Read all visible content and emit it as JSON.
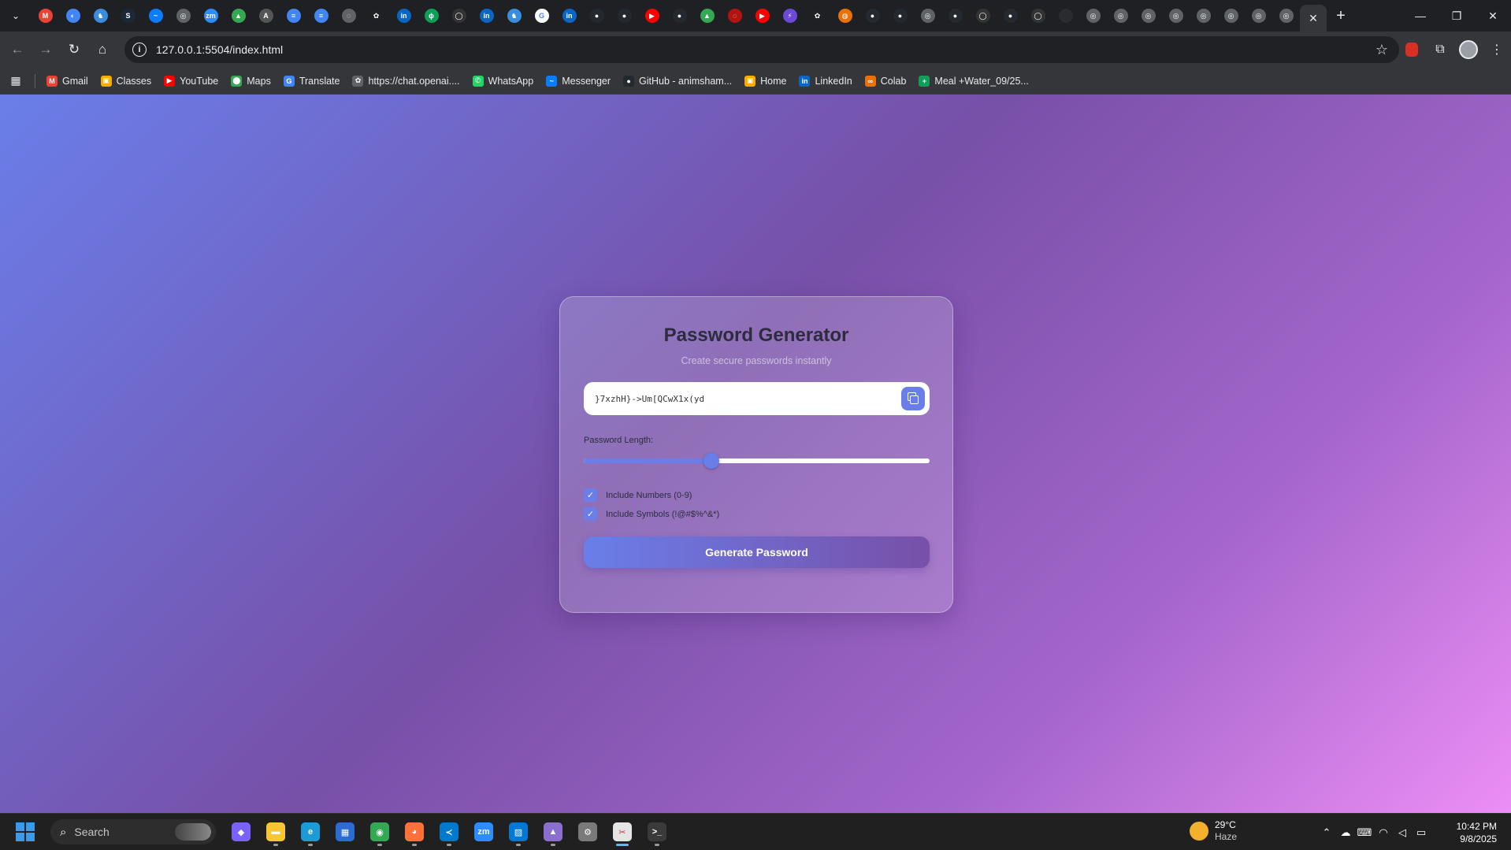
{
  "browser": {
    "url": "127.0.0.1:5504/index.html",
    "tabs": [
      {
        "icon": "gmail-icon",
        "color": "#ea4335",
        "glyph": "M"
      },
      {
        "icon": "chart-icon",
        "color": "#4285f4",
        "glyph": "◐"
      },
      {
        "icon": "github-copilot-icon",
        "color": "#3a8dde",
        "glyph": "♞"
      },
      {
        "icon": "steam-icon",
        "color": "#1b2838",
        "glyph": "S"
      },
      {
        "icon": "messenger-icon",
        "color": "#0a7cff",
        "glyph": "~"
      },
      {
        "icon": "globe-icon",
        "color": "#5f6368",
        "glyph": "◎"
      },
      {
        "icon": "zoom-icon",
        "color": "#2d8cff",
        "glyph": "zm"
      },
      {
        "icon": "drive-icon",
        "color": "#34a853",
        "glyph": "▲"
      },
      {
        "icon": "angular-icon",
        "color": "#555",
        "glyph": "A"
      },
      {
        "icon": "docs-icon",
        "color": "#4285f4",
        "glyph": "≡"
      },
      {
        "icon": "docs-icon",
        "color": "#4285f4",
        "glyph": "≡"
      },
      {
        "icon": "loading-icon",
        "color": "#5f6368",
        "glyph": "◌"
      },
      {
        "icon": "chatgpt-icon",
        "color": "#202124",
        "glyph": "✿"
      },
      {
        "icon": "linkedin-icon",
        "color": "#0a66c2",
        "glyph": "in"
      },
      {
        "icon": "plant-icon",
        "color": "#0f9d58",
        "glyph": "ϕ"
      },
      {
        "icon": "circle-icon",
        "color": "#333",
        "glyph": "◯"
      },
      {
        "icon": "linkedin-icon",
        "color": "#0a66c2",
        "glyph": "in"
      },
      {
        "icon": "copilot-icon",
        "color": "#3a8dde",
        "glyph": "♞"
      },
      {
        "icon": "google-icon",
        "color": "#ffffff",
        "glyph": "G"
      },
      {
        "icon": "linkedin-icon",
        "color": "#0a66c2",
        "glyph": "in"
      },
      {
        "icon": "github-icon",
        "color": "#24292f",
        "glyph": "●"
      },
      {
        "icon": "github-icon",
        "color": "#24292f",
        "glyph": "●"
      },
      {
        "icon": "youtube-icon",
        "color": "#ff0000",
        "glyph": "▶"
      },
      {
        "icon": "github-icon",
        "color": "#24292f",
        "glyph": "●"
      },
      {
        "icon": "drive-icon",
        "color": "#34a853",
        "glyph": "▲"
      },
      {
        "icon": "loading-icon",
        "color": "#b31412",
        "glyph": "◌"
      },
      {
        "icon": "youtube-icon",
        "color": "#ff0000",
        "glyph": "▶"
      },
      {
        "icon": "bolt-icon",
        "color": "#6c4ad8",
        "glyph": "⚡"
      },
      {
        "icon": "chatgpt-icon",
        "color": "#202124",
        "glyph": "✿"
      },
      {
        "icon": "colab-icon",
        "color": "#e8710a",
        "glyph": "◍"
      },
      {
        "icon": "github-icon",
        "color": "#24292f",
        "glyph": "●"
      },
      {
        "icon": "github-icon",
        "color": "#24292f",
        "glyph": "●"
      },
      {
        "icon": "globe-icon",
        "color": "#5f6368",
        "glyph": "◎"
      },
      {
        "icon": "github-icon",
        "color": "#24292f",
        "glyph": "●"
      },
      {
        "icon": "circle-icon",
        "color": "#333",
        "glyph": "◯"
      },
      {
        "icon": "github-icon",
        "color": "#24292f",
        "glyph": "●"
      },
      {
        "icon": "circle-icon",
        "color": "#333",
        "glyph": "◯"
      },
      {
        "icon": "blank-icon",
        "color": "#2a2b2e",
        "glyph": ""
      },
      {
        "icon": "globe-icon",
        "color": "#5f6368",
        "glyph": "◎"
      },
      {
        "icon": "globe-icon",
        "color": "#5f6368",
        "glyph": "◎"
      },
      {
        "icon": "globe-icon",
        "color": "#5f6368",
        "glyph": "◎"
      },
      {
        "icon": "globe-icon",
        "color": "#5f6368",
        "glyph": "◎"
      },
      {
        "icon": "globe-icon",
        "color": "#5f6368",
        "glyph": "◎"
      },
      {
        "icon": "globe-icon",
        "color": "#5f6368",
        "glyph": "◎"
      },
      {
        "icon": "globe-icon",
        "color": "#5f6368",
        "glyph": "◎"
      },
      {
        "icon": "globe-icon",
        "color": "#5f6368",
        "glyph": "◎"
      }
    ],
    "bookmarks": [
      {
        "label": "Gmail",
        "color": "#ea4335",
        "glyph": "M"
      },
      {
        "label": "Classes",
        "color": "#f9ab00",
        "glyph": "▣"
      },
      {
        "label": "YouTube",
        "color": "#ff0000",
        "glyph": "▶"
      },
      {
        "label": "Maps",
        "color": "#34a853",
        "glyph": "⬤"
      },
      {
        "label": "Translate",
        "color": "#4285f4",
        "glyph": "G"
      },
      {
        "label": "https://chat.openai....",
        "color": "#5f6368",
        "glyph": "✿"
      },
      {
        "label": "WhatsApp",
        "color": "#25d366",
        "glyph": "✆"
      },
      {
        "label": "Messenger",
        "color": "#0a7cff",
        "glyph": "~"
      },
      {
        "label": "GitHub - animsham...",
        "color": "#24292f",
        "glyph": "●"
      },
      {
        "label": "Home",
        "color": "#f9ab00",
        "glyph": "▣"
      },
      {
        "label": "LinkedIn",
        "color": "#0a66c2",
        "glyph": "in"
      },
      {
        "label": "Colab",
        "color": "#e8710a",
        "glyph": "∞"
      },
      {
        "label": "Meal +Water_09/25...",
        "color": "#0f9d58",
        "glyph": "+"
      }
    ]
  },
  "app": {
    "title": "Password Generator",
    "subtitle": "Create secure passwords instantly",
    "password": "}7xzhH}->Um[QCwX1x(yd",
    "length_label": "Password Length:",
    "length_value": "",
    "length_fraction": 0.37,
    "numbers_label": "Include Numbers (0-9)",
    "numbers_checked": true,
    "symbols_label": "Include Symbols (!@#$%^&*)",
    "symbols_checked": true,
    "generate_label": "Generate Password",
    "accent_color": "#6a7ee9"
  },
  "taskbar": {
    "search_placeholder": "Search",
    "apps": [
      {
        "name": "copilot-icon",
        "color": "#7b61ff",
        "glyph": "◆"
      },
      {
        "name": "file-explorer-icon",
        "color": "#f8c633",
        "glyph": "▬"
      },
      {
        "name": "edge-icon",
        "color": "#1d9bd6",
        "glyph": "e"
      },
      {
        "name": "store-icon",
        "color": "#2b6cd3",
        "glyph": "▦"
      },
      {
        "name": "chrome-icon",
        "color": "#34a853",
        "glyph": "◉"
      },
      {
        "name": "firefox-icon",
        "color": "#ff7139",
        "glyph": "◕"
      },
      {
        "name": "vscode-icon",
        "color": "#007acc",
        "glyph": "≺"
      },
      {
        "name": "zoom-icon",
        "color": "#2d8cff",
        "glyph": "zm"
      },
      {
        "name": "photos-icon",
        "color": "#0078d4",
        "glyph": "▨"
      },
      {
        "name": "paint-icon",
        "color": "#8a6fd1",
        "glyph": "▲"
      },
      {
        "name": "settings-icon",
        "color": "#7a7a7a",
        "glyph": "⚙"
      },
      {
        "name": "snipping-tool-icon",
        "color": "#e5e5e5",
        "glyph": "✂"
      },
      {
        "name": "terminal-icon",
        "color": "#3a3a3a",
        "glyph": ">_"
      }
    ],
    "weather_temp": "29°C",
    "weather_desc": "Haze",
    "time": "10:42 PM",
    "date": "9/8/2025"
  }
}
